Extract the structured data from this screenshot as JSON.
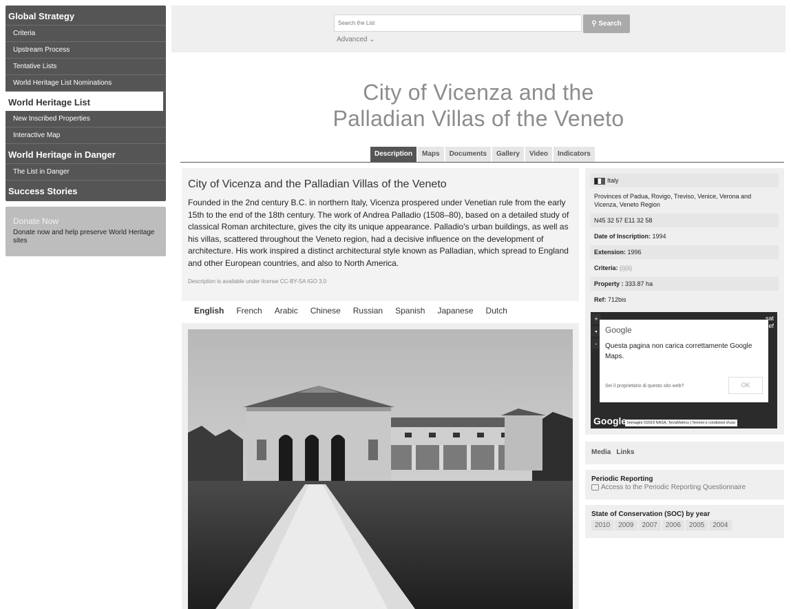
{
  "sidebar": {
    "sections": [
      {
        "heading": "Global Strategy",
        "items": [
          "Criteria",
          "Upstream Process",
          "Tentative Lists",
          "World Heritage List Nominations"
        ]
      },
      {
        "heading": "World Heritage List",
        "items": [
          "New Inscribed Properties",
          "Interactive Map"
        ]
      },
      {
        "heading": "World Heritage in Danger",
        "items": [
          "The List in Danger"
        ]
      },
      {
        "heading": "Success Stories",
        "items": []
      }
    ],
    "donate": {
      "title": "Donate Now",
      "text": "Donate now and help preserve World Heritage sites"
    }
  },
  "search": {
    "placeholder": "Search the List",
    "button": "Search",
    "advanced": "Advanced ⌄"
  },
  "page": {
    "title_line1": "City of Vicenza and the",
    "title_line2": "Palladian Villas of the Veneto"
  },
  "tabs": [
    "Description",
    "Maps",
    "Documents",
    "Gallery",
    "Video",
    "Indicators"
  ],
  "description": {
    "heading": "City of Vicenza and the Palladian Villas of the Veneto",
    "body": "Founded in the 2nd century B.C. in northern Italy, Vicenza prospered under Venetian rule from the early 15th to the end of the 18th century. The work of Andrea Palladio (1508–80), based on a detailed study of classical Roman architecture, gives the city its unique appearance. Palladio's urban buildings, as well as his villas, scattered throughout the Veneto region, had a decisive influence on the development of architecture. His work inspired a distinct architectural style known as Palladian, which spread to England and other European countries, and also to North America.",
    "license": "Description is available under license CC-BY-SA IGO 3.0"
  },
  "languages": [
    "English",
    "French",
    "Arabic",
    "Chinese",
    "Russian",
    "Spanish",
    "Japanese",
    "Dutch"
  ],
  "info": {
    "country": "Italy",
    "location": "Provinces of Padua, Rovigo, Treviso, Venice, Verona and Vicenza, Veneto Region",
    "coords": "N45 32 57 E11 32 58",
    "inscription_label": "Date of Inscription:",
    "inscription_value": "1994",
    "extension_label": "Extension:",
    "extension_value": "1996",
    "criteria_label": "Criteria:",
    "criteria_value": "(i)(ii)",
    "property_label": "Property :",
    "property_value": "333.87 ha",
    "ref_label": "Ref:",
    "ref_value": "712bis"
  },
  "map": {
    "zoom_in": "+",
    "zoom_out": "-",
    "type_line1": "sat",
    "type_line2": "Relief",
    "logo": "Google",
    "message": "Questa pagina non carica correttamente Google Maps.",
    "owner_question": "Sei il proprietario di questo sito web?",
    "ok": "OK",
    "watermark": "Google",
    "credits": "Immagini ©2019 NASA, TerraMetrics  |  Termini e condizioni d'uso"
  },
  "media": [
    "Media",
    "Links"
  ],
  "periodic": {
    "title": "Periodic Reporting",
    "link": "Access to the Periodic Reporting Questionnaire"
  },
  "soc": {
    "title": "State of Conservation (SOC) by year",
    "years": [
      "2010",
      "2009",
      "2007",
      "2006",
      "2005",
      "2004"
    ]
  }
}
